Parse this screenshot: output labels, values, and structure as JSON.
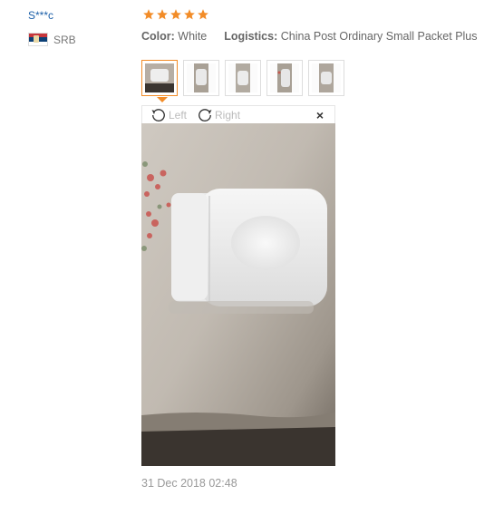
{
  "user": {
    "name": "S***c",
    "country_code": "SRB"
  },
  "rating": {
    "stars": 5,
    "max": 5,
    "color": "#f28c28"
  },
  "attributes": {
    "color_label": "Color:",
    "color_value": "White",
    "logistics_label": "Logistics:",
    "logistics_value": "China Post Ordinary Small Packet Plus"
  },
  "thumbnails": {
    "count": 5,
    "selected_index": 0
  },
  "viewer": {
    "rotate_left_label": "Left",
    "rotate_right_label": "Right",
    "close_label": "×"
  },
  "review_date": "31 Dec 2018 02:48"
}
